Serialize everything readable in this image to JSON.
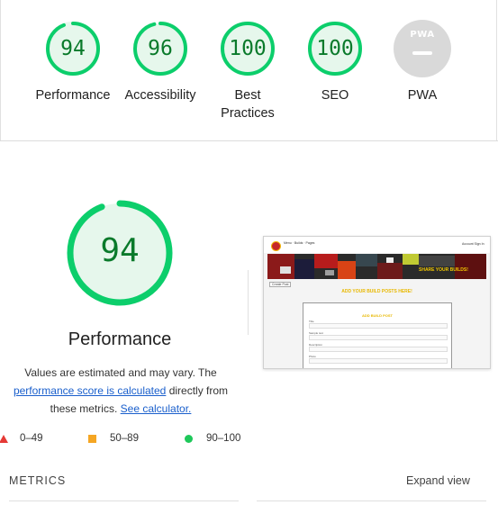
{
  "summary": {
    "categories": [
      {
        "label": "Performance",
        "score": "94",
        "score_value": 94,
        "status": "pass"
      },
      {
        "label": "Accessibility",
        "score": "96",
        "score_value": 96,
        "status": "pass"
      },
      {
        "label": "Best",
        "label2": "Practices",
        "score": "100",
        "score_value": 100,
        "status": "pass"
      },
      {
        "label": "SEO",
        "score": "100",
        "score_value": 100,
        "status": "pass"
      },
      {
        "label": "PWA",
        "score": "",
        "status": "na",
        "badge": "PWA"
      }
    ]
  },
  "performance": {
    "score": "94",
    "score_value": 94,
    "title": "Performance",
    "desc_line1": "Values are estimated and may vary. The",
    "desc_link1": "performance score is calculated",
    "desc_mid": "directly from",
    "desc_line3": "these metrics.",
    "desc_link2": "See calculator."
  },
  "legend": [
    {
      "range": "0–49",
      "shape": "triangle",
      "color": "#e53935"
    },
    {
      "range": "50–89",
      "shape": "square",
      "color": "#f5a623"
    },
    {
      "range": "90–100",
      "shape": "circle",
      "color": "#1ec85a"
    }
  ],
  "screenshot": {
    "nav_text": "Menu · Builds · Pages",
    "nav_right": "Account Sign In",
    "banner_text": "SHARE YOUR BUILDS!",
    "button_text": "Create Post",
    "headline": "ADD YOUR BUILD POSTS HERE!",
    "form_title": "ADD BUILD POST",
    "form_labels": [
      "Title",
      "Sample text",
      "Description",
      "Photo"
    ]
  },
  "metrics": {
    "title": "METRICS",
    "expand_label": "Expand view"
  },
  "colors": {
    "pass_ring": "#0cce6b",
    "pass_fill": "#e6f7ec",
    "pass_text": "#0a7a2b",
    "na_gray": "#d9d9d9"
  }
}
